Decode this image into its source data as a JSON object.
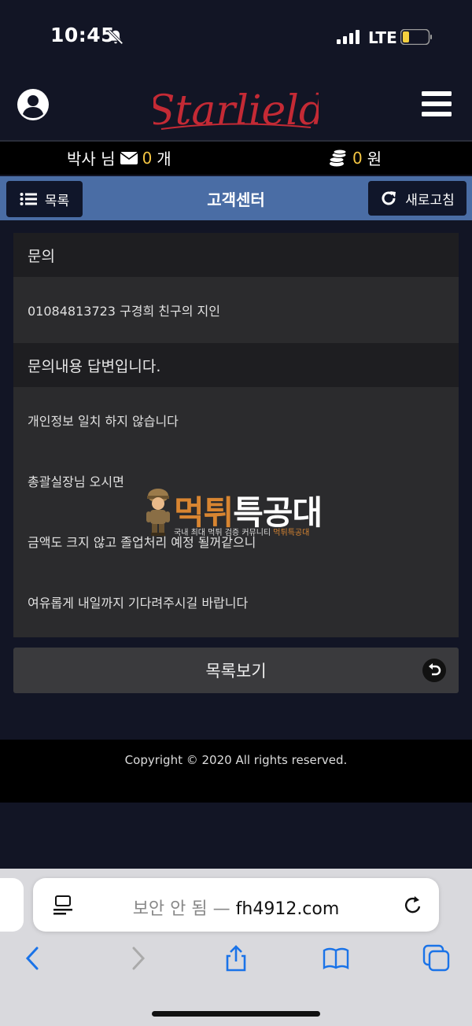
{
  "status_bar": {
    "time": "10:45",
    "network": "LTE"
  },
  "header": {
    "logo_text": "Starlield"
  },
  "info_bar": {
    "user_name": "박사 님",
    "message_count": "0",
    "message_unit": "개",
    "money_amount": "0",
    "money_unit": "원"
  },
  "title_bar": {
    "list_label": "목록",
    "title": "고객센터",
    "refresh_label": "새로고침"
  },
  "inquiry": {
    "heading": "문의",
    "content": "01084813723 구경희 친구의 지인",
    "answer_heading": "문의내용 답변입니다.",
    "answer_lines": [
      "개인정보 일치 하지 않습니다",
      "총괄실장님 오시면",
      "금액도 크지 않고 졸업처리 예정 될꺼같으니",
      "여유롭게 내일까지 기다려주시길 바랍니다"
    ]
  },
  "watermark": {
    "title_part1": "먹튀",
    "title_part2": "특공대",
    "subtitle_part1": "국내 최대 먹튀 검증 커뮤니티 ",
    "subtitle_part2": "먹튀특공대"
  },
  "list_view_label": "목록보기",
  "footer": {
    "copyright": "Copyright © 2020 All rights reserved."
  },
  "browser": {
    "security_text": "보안 안 됨 —",
    "domain": "fh4912.com"
  },
  "colors": {
    "accent_yellow": "#f4c542",
    "title_bar": "#4a6da5",
    "logo_red": "#c42a35",
    "background": "#121525"
  }
}
